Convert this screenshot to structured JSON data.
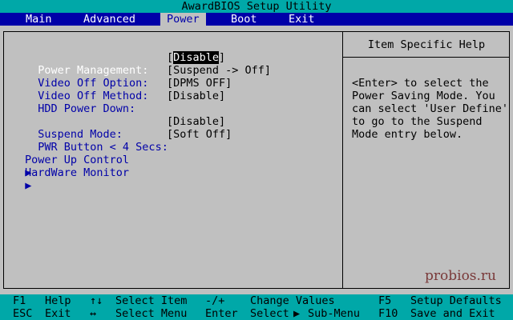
{
  "title": "AwardBIOS Setup Utility",
  "menu": {
    "main": "Main",
    "advanced": "Advanced",
    "power": "Power",
    "boot": "Boot",
    "exit": "Exit"
  },
  "settings": {
    "power_management": {
      "label": "Power Management:",
      "value_open": "[",
      "value": "Disable",
      "value_close": "]"
    },
    "video_off_option": {
      "label": "Video Off Option:",
      "value": "[Suspend -> Off]"
    },
    "video_off_method": {
      "label": "Video Off Method:",
      "value": "[DPMS OFF]"
    },
    "hdd_power_down": {
      "label": "HDD Power Down:",
      "value": "[Disable]"
    },
    "suspend_mode": {
      "label": "Suspend Mode:",
      "value": "[Disable]"
    },
    "pwr_button": {
      "label": "PWR Button < 4 Secs:",
      "value": "[Soft Off]"
    }
  },
  "submenus": {
    "power_up_control": "Power Up Control",
    "hardware_monitor": "HardWare Monitor",
    "arrow": "▶"
  },
  "help": {
    "title": "Item Specific Help",
    "lines": [
      "<Enter> to select the",
      "Power Saving Mode. You",
      "can select 'User Define'",
      "to go to the Suspend",
      "Mode entry below."
    ]
  },
  "watermark": "probios.ru",
  "status": {
    "f1": "F1",
    "help": "Help",
    "updown": "↑↓",
    "select_item": "Select Item",
    "minus_plus": "-/+",
    "change_values": "Change Values",
    "f5": "F5",
    "setup_defaults": "Setup Defaults",
    "esc": "ESC",
    "exit": "Exit",
    "leftright": "↔",
    "select_menu": "Select Menu",
    "enter": "Enter",
    "select_prefix": "Select",
    "sub_menu_arrow": "▶",
    "sub_menu": "Sub-Menu",
    "f10": "F10",
    "save_and_exit": "Save and Exit"
  },
  "colors": {
    "background": "#c0c0c0",
    "menu_bar": "#0000a8",
    "title_bar": "#00a8a8",
    "label_blue": "#0000a8"
  }
}
